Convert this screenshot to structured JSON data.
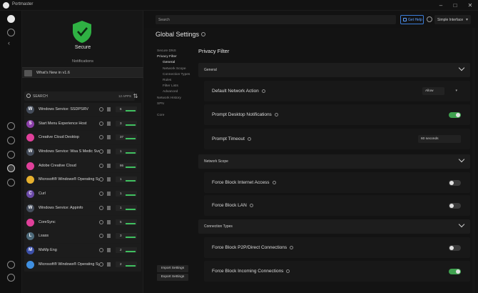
{
  "window": {
    "title": "Portmaster",
    "controls": [
      "–",
      "□",
      "✕"
    ]
  },
  "status": {
    "label": "Secure",
    "color": "#3cc24a"
  },
  "notifications": {
    "title": "Notifications",
    "items": [
      "What's New in v1.6"
    ]
  },
  "app_search": {
    "placeholder": "SEARCH",
    "count": "12 APPS"
  },
  "apps": [
    {
      "name": "Windows Service: SSDPSRV",
      "letter": "W",
      "color": "#444c5a",
      "count": "6"
    },
    {
      "name": "Start Menu Experience Host",
      "letter": "S",
      "color": "#8b3fa8",
      "count": "3"
    },
    {
      "name": "Creative Cloud Desktop",
      "letter": "",
      "color": "#e0409a",
      "count": "37"
    },
    {
      "name": "Windows Service: Wsa S Medic Svc",
      "letter": "W",
      "color": "#444c5a",
      "count": "1"
    },
    {
      "name": "Adobe Creative Cloud",
      "letter": "",
      "color": "#e0409a",
      "count": "86"
    },
    {
      "name": "Microsoft® Windows® Operating System",
      "letter": "",
      "color": "#e6b02e",
      "count": "1"
    },
    {
      "name": "Curl",
      "letter": "C",
      "color": "#6c4aa8",
      "count": "1"
    },
    {
      "name": "Windows Service: Appinfo",
      "letter": "W",
      "color": "#444c5a",
      "count": "1"
    },
    {
      "name": "CoreSync",
      "letter": "",
      "color": "#e0409a",
      "count": "5"
    },
    {
      "name": "Lsass",
      "letter": "L",
      "color": "#4d6a7a",
      "count": "3"
    },
    {
      "name": "MsMp Eng",
      "letter": "M",
      "color": "#3b4fa8",
      "count": "2"
    },
    {
      "name": "Microsoft® Windows® Operating System",
      "letter": "",
      "color": "#3f8fe0",
      "count": "2"
    }
  ],
  "topbar": {
    "search_placeholder": "Search",
    "help": "Get Help",
    "interface": "Simple Interface"
  },
  "page": {
    "title": "Global Settings"
  },
  "tree": [
    {
      "label": "Secure DNS",
      "level": 0,
      "state": ""
    },
    {
      "label": "Privacy Filter",
      "level": 0,
      "state": "open"
    },
    {
      "label": "General",
      "level": 1,
      "state": "active"
    },
    {
      "label": "Network Scope",
      "level": 1,
      "state": ""
    },
    {
      "label": "Connection Types",
      "level": 1,
      "state": ""
    },
    {
      "label": "Rules",
      "level": 1,
      "state": ""
    },
    {
      "label": "Filter Lists",
      "level": 1,
      "state": ""
    },
    {
      "label": "Advanced",
      "level": 1,
      "state": ""
    },
    {
      "label": "Network History",
      "level": 0,
      "state": ""
    },
    {
      "label": "SPN",
      "level": 0,
      "state": ""
    },
    {
      "label": "",
      "level": 0,
      "state": ""
    },
    {
      "label": "Core",
      "level": 0,
      "state": ""
    }
  ],
  "buttons": {
    "import": "Import Settings",
    "export": "Export Settings"
  },
  "content": {
    "title": "Privacy Filter",
    "sections": [
      {
        "title": "General"
      },
      {
        "title": "Network Scope"
      },
      {
        "title": "Connection Types"
      }
    ],
    "settings": {
      "default_action": {
        "label": "Default Network Action",
        "value": "Allow"
      },
      "prompt_notifications": {
        "label": "Prompt Desktop Notifications",
        "on": true
      },
      "prompt_timeout": {
        "label": "Prompt Timeout",
        "value": "60 seconds"
      },
      "block_internet": {
        "label": "Force Block Internet Access",
        "on": false
      },
      "block_lan": {
        "label": "Force Block LAN",
        "on": false
      },
      "block_p2p": {
        "label": "Force Block P2P/Direct Connections",
        "on": false
      },
      "block_incoming": {
        "label": "Force Block Incoming Connections",
        "on": true
      }
    }
  }
}
